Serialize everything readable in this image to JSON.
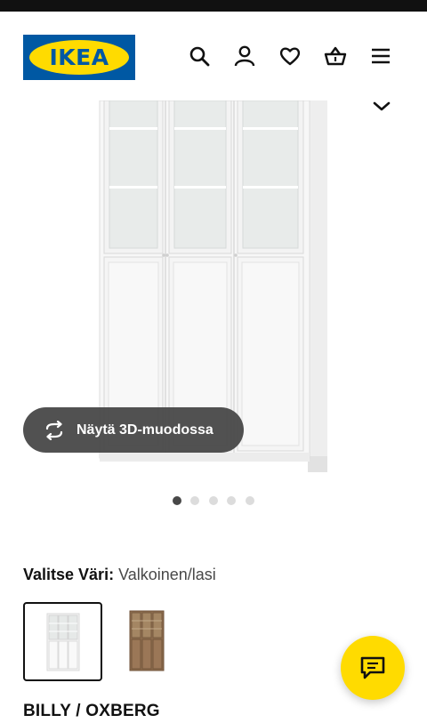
{
  "header": {
    "logo_text": "IKEA",
    "icons": [
      "search-icon",
      "user-icon",
      "heart-icon",
      "basket-icon",
      "menu-icon"
    ]
  },
  "gallery": {
    "view_3d_label": "Näytä 3D-muodossa",
    "image_count": 5,
    "active_index": 0
  },
  "color": {
    "label": "Valitse Väri:",
    "value": "Valkoinen/lasi",
    "options": [
      "white-glass",
      "walnut-glass"
    ],
    "selected_index": 0
  },
  "product": {
    "name": "BILLY / OXBERG"
  },
  "colors": {
    "brand_blue": "#0058a3",
    "brand_yellow": "#ffdb00",
    "pill_bg": "#484848"
  }
}
